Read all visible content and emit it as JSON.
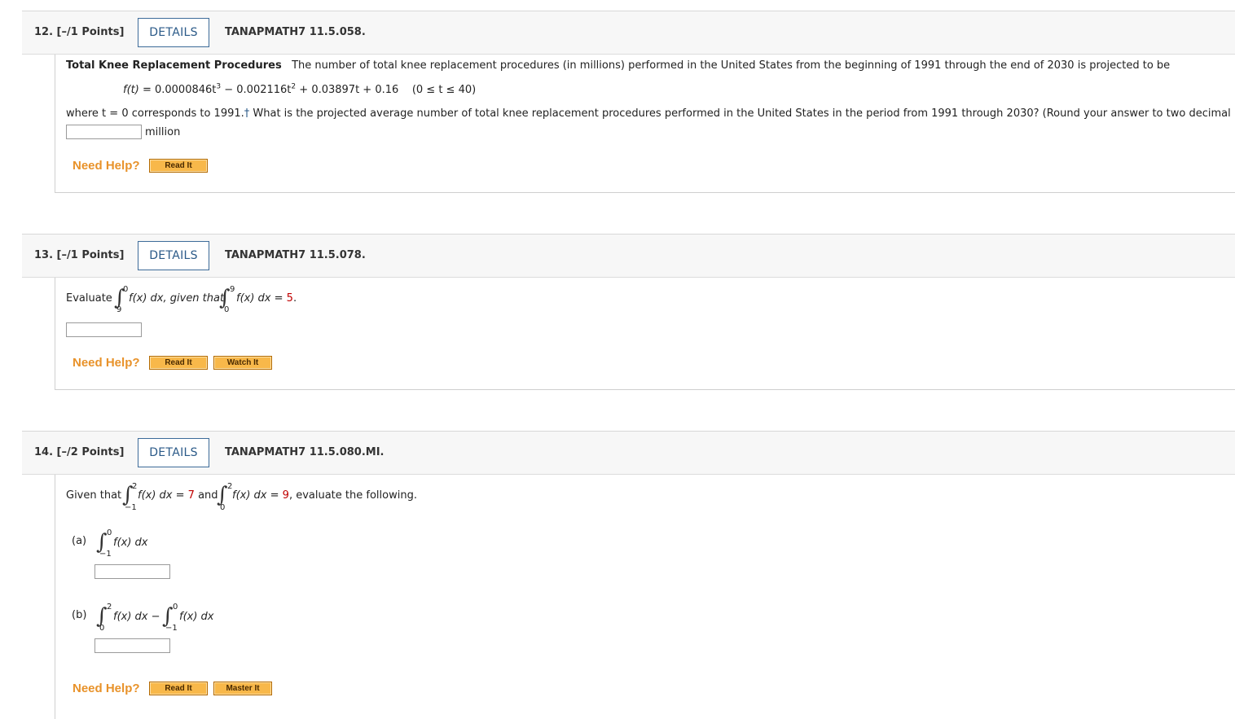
{
  "q12": {
    "number": "12.  [–/1 Points]",
    "details_label": "DETAILS",
    "code": "TANAPMATH7 11.5.058.",
    "title": "Total Knee Replacement Procedures",
    "intro": "The number of total knee replacement procedures (in millions) performed in the United States from the beginning of 1991 through the end of 2030 is projected to be",
    "formula_lhs": "f(t)",
    "formula_t1": " = 0.0000846t",
    "formula_t2": " − 0.002116t",
    "formula_t3": " + 0.03897t + 0.16",
    "formula_domain": "(0 ≤ t ≤ 40)",
    "exp3": "3",
    "exp2": "2",
    "where_text": "where t = 0 corresponds to 1991.",
    "dagger": "†",
    "question": " What is the projected average number of total knee replacement procedures performed in the United States in the period from 1991 through 2030? (Round your answer to two decimal places.)",
    "answer_value": "",
    "unit": "million",
    "need_help": "Need Help?",
    "read_it": "Read It"
  },
  "q13": {
    "number": "13.  [–/1 Points]",
    "details_label": "DETAILS",
    "code": "TANAPMATH7 11.5.078.",
    "evaluate": "Evaluate",
    "int1_upper": "0",
    "int1_lower": "9",
    "integrand1": "f(x) dx, given that",
    "int2_upper": "9",
    "int2_lower": "0",
    "integrand2": "f(x) dx = ",
    "given_value": "5",
    "period": ".",
    "answer_value": "",
    "need_help": "Need Help?",
    "read_it": "Read It",
    "watch_it": "Watch It"
  },
  "q14": {
    "number": "14.  [–/2 Points]",
    "details_label": "DETAILS",
    "code": "TANAPMATH7 11.5.080.MI.",
    "given_that": "Given that",
    "int1_upper": "2",
    "int1_lower": "−1",
    "integrand1": "f(x) dx = ",
    "value1": "7",
    "and_text": " and",
    "int2_upper": "2",
    "int2_lower": "0",
    "integrand2": "f(x) dx = ",
    "value2": "9",
    "tail": ", evaluate the following.",
    "part_a_label": "(a)",
    "a_upper": "0",
    "a_lower": "−1",
    "a_integrand": "f(x) dx",
    "part_b_label": "(b)",
    "b1_upper": "2",
    "b1_lower": "0",
    "b1_integrand": "f(x) dx −",
    "b2_upper": "0",
    "b2_lower": "−1",
    "b2_integrand": "f(x) dx",
    "answer_a": "",
    "answer_b": "",
    "need_help": "Need Help?",
    "read_it": "Read It",
    "master_it": "Master It"
  }
}
